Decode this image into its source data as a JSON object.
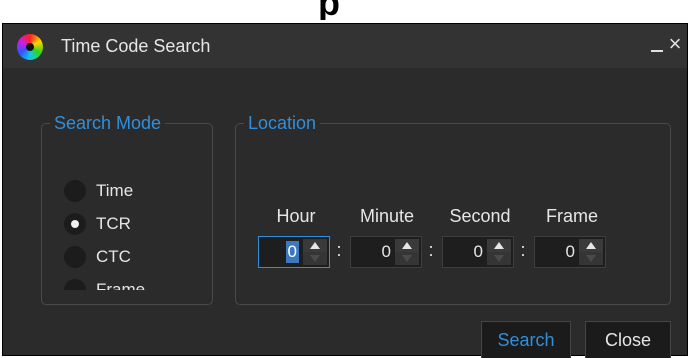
{
  "window": {
    "title": "Time Code Search",
    "minimize_label": "",
    "close_glyph": "×",
    "logo_icon": "color-wheel-icon"
  },
  "search_mode": {
    "legend": "Search Mode",
    "options": [
      {
        "label": "Time",
        "checked": false
      },
      {
        "label": "TCR",
        "checked": true
      },
      {
        "label": "CTC",
        "checked": false
      },
      {
        "label": "Frame",
        "checked": false
      }
    ],
    "selected": "TCR"
  },
  "location": {
    "legend": "Location",
    "fields": [
      {
        "label": "Hour",
        "value": "0"
      },
      {
        "label": "Minute",
        "value": "0"
      },
      {
        "label": "Second",
        "value": "0"
      },
      {
        "label": "Frame",
        "value": "0"
      }
    ],
    "separator": ":"
  },
  "buttons": {
    "search": "Search",
    "close": "Close"
  },
  "colors": {
    "accent": "#2f8fdc",
    "background": "#2b2b2b",
    "text": "#e6e6e6"
  }
}
